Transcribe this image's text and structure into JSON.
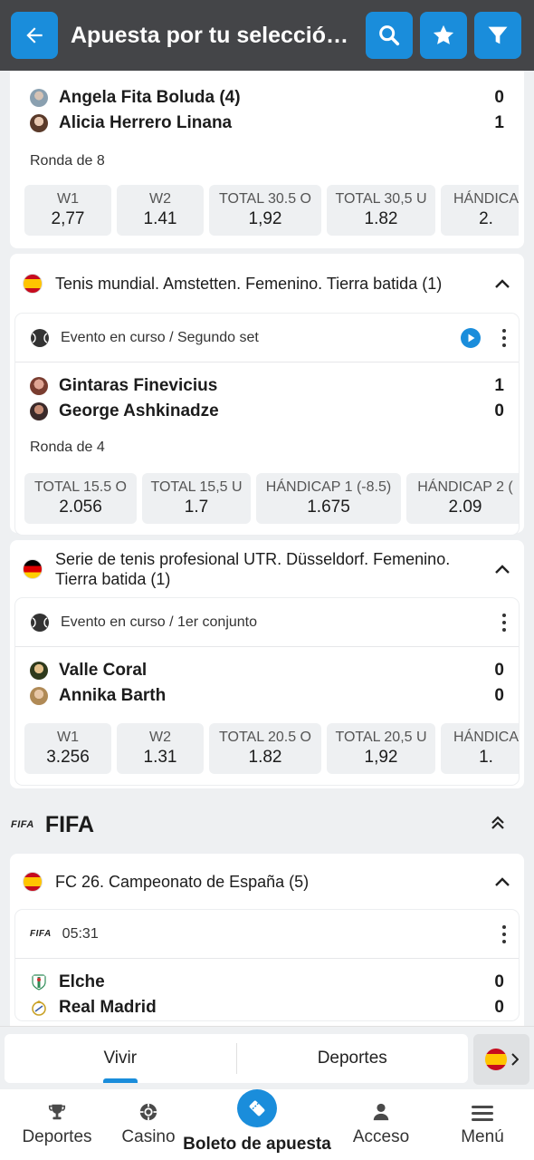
{
  "header": {
    "title": "Apuesta por tu selección ..."
  },
  "colors": {
    "accent": "#1a8ddb",
    "header_bg": "#444548"
  },
  "card1": {
    "teams": [
      {
        "name": "Angela Fita Boluda (4)",
        "score": "0"
      },
      {
        "name": "Alicia Herrero Linana",
        "score": "1"
      }
    ],
    "round": "Ronda de 8",
    "odds": [
      {
        "label": "W1",
        "value": "2,77"
      },
      {
        "label": "W2",
        "value": "1.41"
      },
      {
        "label": "TOTAL 30.5 O",
        "value": "1,92"
      },
      {
        "label": "TOTAL 30,5 U",
        "value": "1.82"
      },
      {
        "label": "HÁNDICA",
        "value": "2."
      }
    ]
  },
  "card2": {
    "league": "Tenis mundial. Amstetten. Femenino. Tierra batida (1)",
    "status": "Evento en curso / Segundo set",
    "teams": [
      {
        "name": "Gintaras Finevicius",
        "score": "1"
      },
      {
        "name": "George Ashkinadze",
        "score": "0"
      }
    ],
    "round": "Ronda de 4",
    "odds": [
      {
        "label": "TOTAL 15.5 O",
        "value": "2.056"
      },
      {
        "label": "TOTAL 15,5 U",
        "value": "1.7"
      },
      {
        "label": "HÁNDICAP 1 (-8.5)",
        "value": "1.675"
      },
      {
        "label": "HÁNDICAP 2 (",
        "value": "2.09"
      }
    ]
  },
  "card3": {
    "league": "Serie de tenis profesional UTR. Düsseldorf. Femenino. Tierra batida (1)",
    "status": "Evento en curso / 1er conjunto",
    "teams": [
      {
        "name": "Valle Coral",
        "score": "0"
      },
      {
        "name": "Annika Barth",
        "score": "0"
      }
    ],
    "odds": [
      {
        "label": "W1",
        "value": "3.256"
      },
      {
        "label": "W2",
        "value": "1.31"
      },
      {
        "label": "TOTAL 20.5 O",
        "value": "1.82"
      },
      {
        "label": "TOTAL 20,5 U",
        "value": "1,92"
      },
      {
        "label": "HÁNDICA",
        "value": "1."
      }
    ]
  },
  "fifa": {
    "logo": "FIFA",
    "title": "FIFA",
    "league": "FC 26. Campeonato de España (5)",
    "time": "05:31",
    "teams": [
      {
        "name": "Elche",
        "score": "0"
      },
      {
        "name": "Real Madrid",
        "score": "0"
      }
    ]
  },
  "switcher": {
    "tabs": [
      "Vivir",
      "Deportes"
    ]
  },
  "nav": {
    "items": [
      "Deportes",
      "Casino",
      "Boleto de apuesta",
      "Acceso",
      "Menú"
    ]
  }
}
